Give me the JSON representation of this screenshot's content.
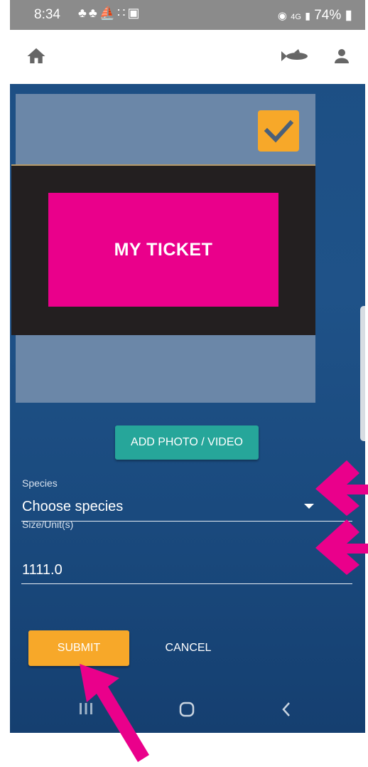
{
  "status_bar": {
    "time": "8:34",
    "notification_icons": [
      "snapchat-icon",
      "snapchat-icon",
      "sailboat-icon",
      "dots-icon",
      "image-icon"
    ],
    "network": "4G",
    "battery": "74%"
  },
  "app_bar": {
    "icons": [
      "home-icon",
      "fish-icon",
      "user-icon"
    ]
  },
  "photo": {
    "ticket_text": "MY TICKET",
    "checked": true
  },
  "buttons": {
    "add_photo": "ADD PHOTO / VIDEO",
    "submit": "SUBMIT",
    "cancel": "CANCEL"
  },
  "form": {
    "species_label": "Species",
    "species_value": "Choose species",
    "size_label": "Size/Unit(s)",
    "size_value": "1111.0"
  },
  "colors": {
    "accent_orange": "#f7a829",
    "teal": "#26a69a",
    "ticket_magenta": "#ea008b",
    "annotation_arrow": "#ea008b",
    "background_blue": "#1c4e83"
  }
}
